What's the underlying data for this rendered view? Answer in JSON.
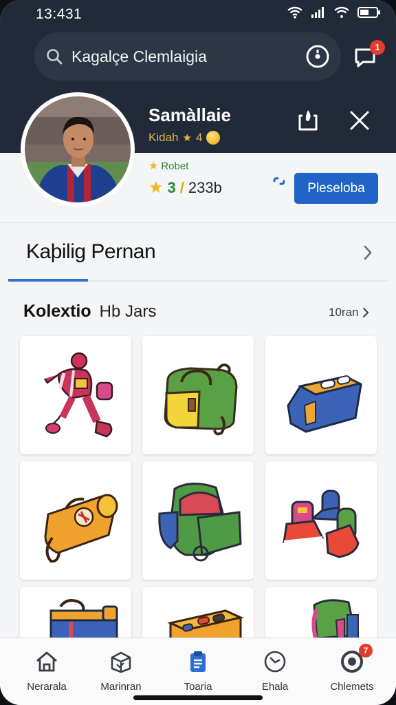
{
  "status_bar": {
    "time": "13:431"
  },
  "search": {
    "text": "Kagalçe Clemlaigia"
  },
  "header": {
    "chat_badge": "1"
  },
  "profile": {
    "name": "Samàllaie",
    "subtitle": "Kidah",
    "subtitle_value": "4",
    "rank": "Robet",
    "stats_count": "3",
    "stats_value": "233b",
    "primary_button": "Pleseloba"
  },
  "section": {
    "title": "Kaþilig Pernan"
  },
  "collection": {
    "title_bold": "Kolextio",
    "title_regular": "Hb Jars",
    "see_all": "10ran"
  },
  "items": [
    {
      "name": "football-player-sticker"
    },
    {
      "name": "green-yellow-duffel-bag"
    },
    {
      "name": "blue-orange-gym-bag"
    },
    {
      "name": "orange-travel-bag"
    },
    {
      "name": "green-backpack"
    },
    {
      "name": "sneakers-and-socks"
    },
    {
      "name": "blue-cooler-bag"
    },
    {
      "name": "orange-toolbox"
    },
    {
      "name": "green-pink-backpack"
    }
  ],
  "bottom_nav": [
    {
      "label": "Nerarala",
      "icon": "home-icon"
    },
    {
      "label": "Marinran",
      "icon": "package-icon"
    },
    {
      "label": "Toaria",
      "icon": "clipboard-icon",
      "active": true
    },
    {
      "label": "Ehala",
      "icon": "clock-icon"
    },
    {
      "label": "Chlemets",
      "icon": "target-icon",
      "badge": "7"
    }
  ],
  "colors": {
    "accent": "#1f64c6",
    "header_bg": "#202a38",
    "badge": "#e23b2f"
  }
}
